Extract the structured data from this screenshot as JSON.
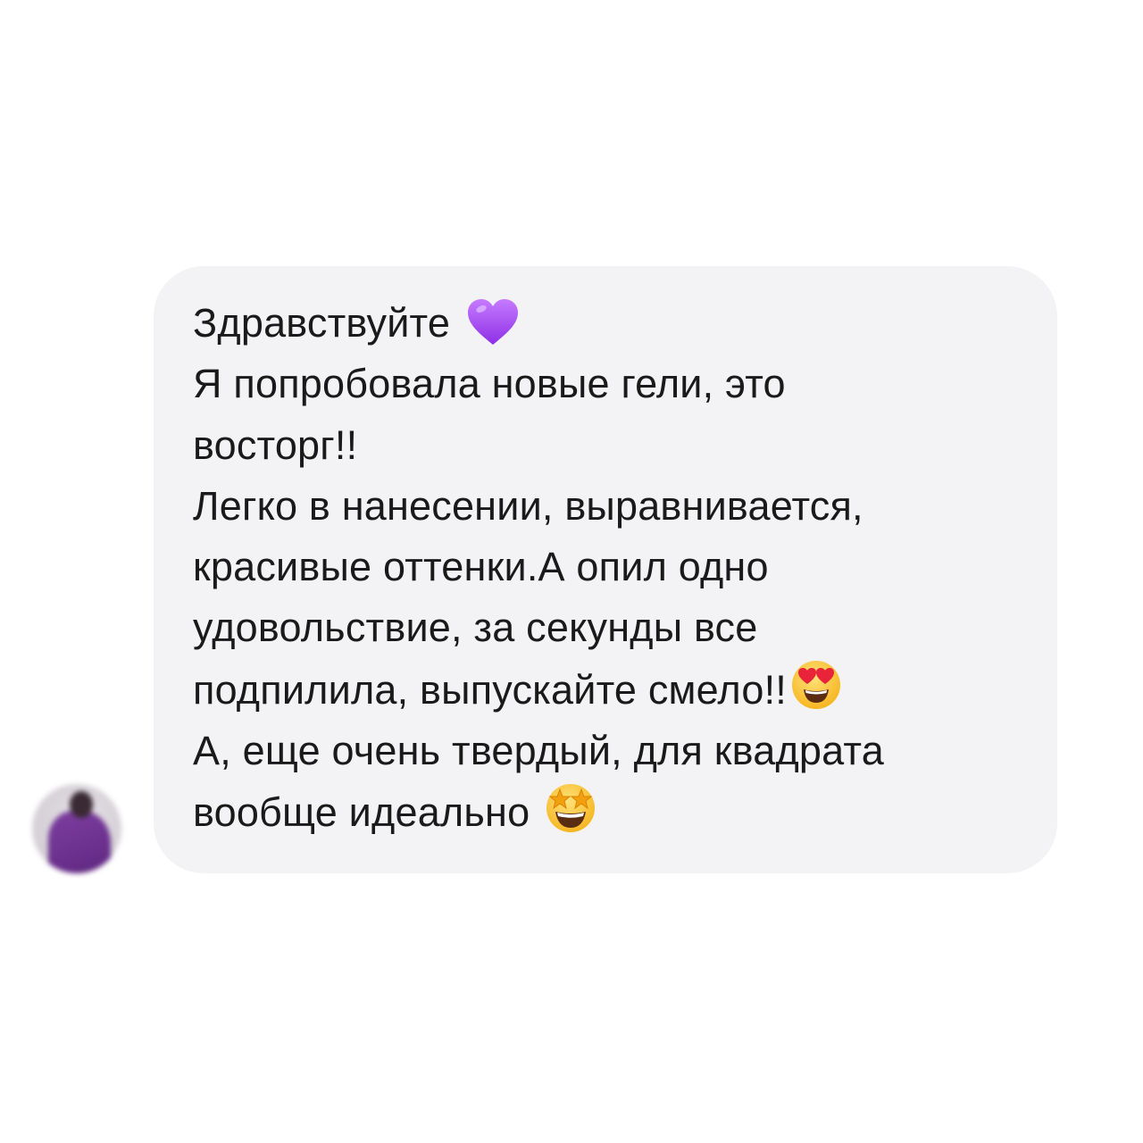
{
  "message": {
    "lines": [
      "Здравствуйте",
      "Я попробовала новые гели, это",
      "восторг!!",
      "Легко в нанесении, выравнивается,",
      "красивые оттенки.А опил одно",
      "удовольствие, за секунды все",
      "подпилила, выпускайте смело!!",
      "А, еще очень твердый, для квадрата",
      "вообще идеально"
    ],
    "emojis": {
      "line_0": "purple-heart-icon",
      "line_6": "heart-eyes-face-icon",
      "line_8": "star-struck-face-icon"
    }
  },
  "colors": {
    "bubble": "#f3f3f5",
    "text": "#1a1a1a",
    "background": "#ffffff",
    "heart": "#a64ef0"
  }
}
